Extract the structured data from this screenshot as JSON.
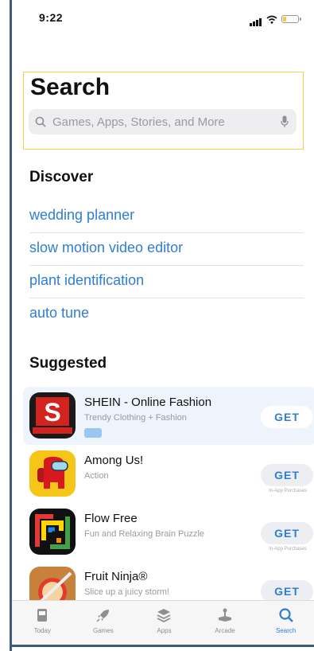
{
  "status": {
    "time": "9:22"
  },
  "header": {
    "title": "Search",
    "search_placeholder": "Games, Apps, Stories, and More"
  },
  "discover": {
    "title": "Discover",
    "items": [
      "wedding planner",
      "slow motion video editor",
      "plant identification",
      "auto tune"
    ]
  },
  "suggested": {
    "title": "Suggested",
    "apps": [
      {
        "name": "SHEIN - Online Fashion",
        "subtitle": "Trendy Clothing + Fashion",
        "get": "GET",
        "iap": "",
        "icon": "shein-icon"
      },
      {
        "name": "Among Us!",
        "subtitle": "Action",
        "get": "GET",
        "iap": "In-App Purchases",
        "icon": "among-us-icon"
      },
      {
        "name": "Flow Free",
        "subtitle": "Fun and Relaxing Brain Puzzle",
        "get": "GET",
        "iap": "In-App Purchases",
        "icon": "flow-free-icon"
      },
      {
        "name": "Fruit Ninja®",
        "subtitle": "Slice up a juicy storm!",
        "get": "GET",
        "iap": "",
        "icon": "fruit-ninja-icon"
      }
    ]
  },
  "tabs": [
    {
      "label": "Today",
      "icon": "today-icon"
    },
    {
      "label": "Games",
      "icon": "rocket-icon"
    },
    {
      "label": "Apps",
      "icon": "layers-icon"
    },
    {
      "label": "Arcade",
      "icon": "joystick-icon"
    },
    {
      "label": "Search",
      "icon": "search-icon"
    }
  ],
  "colors": {
    "accent": "#2f7dd6",
    "highlight_border": "#f3d34a",
    "frame": "#3d5a80"
  }
}
